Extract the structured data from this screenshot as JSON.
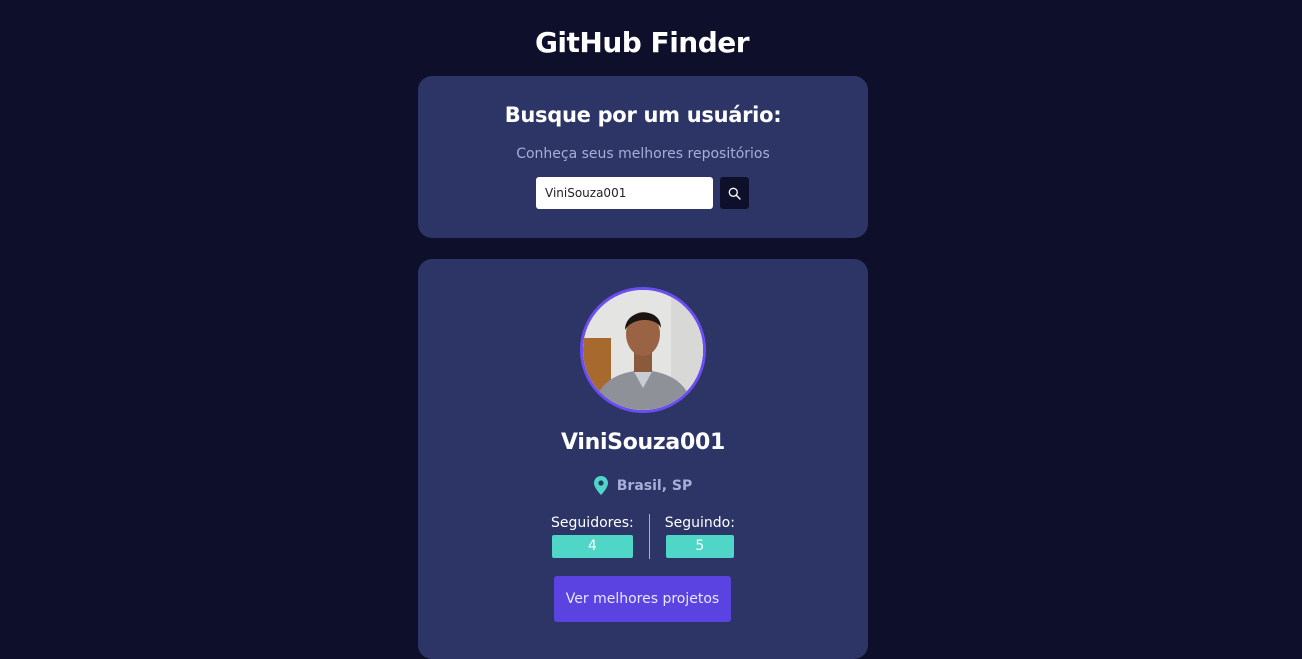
{
  "app": {
    "title": "GitHub Finder"
  },
  "search": {
    "heading": "Busque por um usuário:",
    "subtitle": "Conheça seus melhores repositórios",
    "input_value": "ViniSouza001",
    "button_icon": "search-icon"
  },
  "profile": {
    "avatar_icon": "avatar",
    "username": "ViniSouza001",
    "location_icon": "map-pin-icon",
    "location": "Brasil, SP",
    "followers_label": "Seguidores:",
    "followers_count": "4",
    "following_label": "Seguindo:",
    "following_count": "5",
    "projects_button_label": "Ver melhores projetos"
  },
  "colors": {
    "background": "#0e0f2a",
    "card": "#2d3566",
    "accent_purple": "#5a43e0",
    "avatar_border": "#6a4ef0",
    "teal": "#4fd6c6",
    "muted_text": "#a6aed8"
  }
}
